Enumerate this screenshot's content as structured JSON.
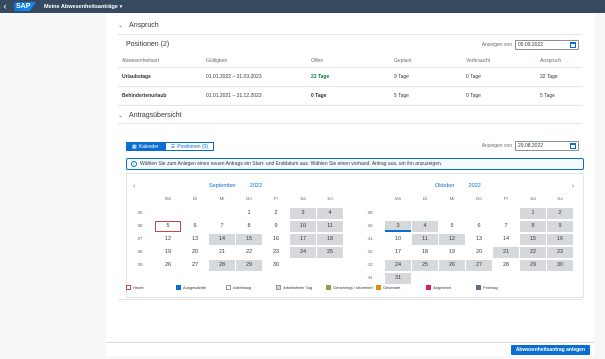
{
  "shell": {
    "logo": "SAP",
    "title": "Meine Abwesenheitsanträge"
  },
  "anspruch": {
    "heading": "Anspruch",
    "positions_title": "Positionen (2)",
    "date_label": "Anzeigen von",
    "date_value": "05.09.2022",
    "columns": [
      "Abwesenheitsart",
      "Gültigkeit",
      "Offen",
      "Geplant",
      "Verbraucht",
      "Anspruch"
    ],
    "rows": [
      {
        "type": "Urlaubstage",
        "validity": "01.01.2022 – 31.03.2023",
        "open": "23 Tage",
        "planned": "9 Tage",
        "used": "0 Tage",
        "entitlement": "32 Tage"
      },
      {
        "type": "Behindertenurlaub",
        "validity": "01.01.2021 – 31.12.2022",
        "open": "0 Tage",
        "planned": "5 Tage",
        "used": "0 Tage",
        "entitlement": "5 Tage"
      }
    ]
  },
  "overview": {
    "heading": "Antragsübersicht",
    "tab_calendar": "Kalender",
    "tab_positions": "Positionen (0)",
    "date_label": "Anzeigen von",
    "date_value": "29.08.2022",
    "info_text": "Wählen Sie zum Anlegen eines neuen Antrags ein Start- und Enddatum aus. Wählen Sie einen vorhand. Antrag aus, um ihn anzuzeigen.",
    "weekdays": [
      "Mo",
      "Di",
      "Mi",
      "Do",
      "Fr",
      "Sa",
      "So"
    ],
    "september": {
      "month": "September",
      "year": "2022",
      "weeks": [
        "35",
        "36",
        "37",
        "38",
        "39"
      ],
      "days": [
        [
          "",
          "",
          "",
          "1",
          "2",
          "3",
          "4"
        ],
        [
          "5",
          "6",
          "7",
          "8",
          "9",
          "10",
          "11"
        ],
        [
          "12",
          "13",
          "14",
          "15",
          "16",
          "17",
          "18"
        ],
        [
          "19",
          "20",
          "21",
          "22",
          "23",
          "24",
          "25"
        ],
        [
          "26",
          "27",
          "28",
          "29",
          "30",
          "",
          ""
        ]
      ]
    },
    "october": {
      "month": "Oktober",
      "year": "2022",
      "weeks": [
        "39",
        "40",
        "41",
        "42",
        "43",
        "44"
      ],
      "days": [
        [
          "",
          "",
          "",
          "",
          "",
          "1",
          "2"
        ],
        [
          "3",
          "4",
          "5",
          "6",
          "7",
          "8",
          "9"
        ],
        [
          "10",
          "11",
          "12",
          "13",
          "14",
          "15",
          "16"
        ],
        [
          "17",
          "18",
          "19",
          "20",
          "21",
          "22",
          "23"
        ],
        [
          "24",
          "25",
          "26",
          "27",
          "28",
          "29",
          "30"
        ],
        [
          "31",
          "",
          "",
          "",
          "",
          "",
          ""
        ]
      ]
    },
    "legend": [
      {
        "label": "Heute",
        "color": "#ffffff",
        "border": "#d04343"
      },
      {
        "label": "Ausgewählte",
        "color": "#0a6ed1",
        "border": "#0a6ed1"
      },
      {
        "label": "Arbeitstag",
        "color": "#ffffff",
        "border": "#999999"
      },
      {
        "label": "Arbeitsfreier Tag",
        "color": "#d5d9dc",
        "border": "#999999"
      },
      {
        "label": "Genehmigt / Informiert",
        "color": "#8d9f4c",
        "border": "#8d9f4c"
      },
      {
        "label": "Gesendet",
        "color": "#e78c07",
        "border": "#e78c07"
      },
      {
        "label": "Abgelehnt",
        "color": "#d6205e",
        "border": "#d6205e"
      },
      {
        "label": "Feiertag",
        "color": "#5f6e7c",
        "border": "#5f6e7c"
      }
    ]
  },
  "footer": {
    "create_button": "Abwesenheitsantrag anlegen"
  }
}
